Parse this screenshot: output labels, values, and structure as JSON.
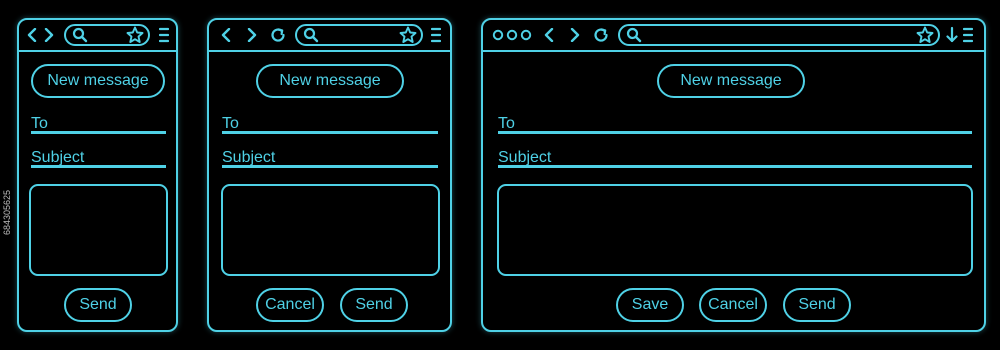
{
  "windows": [
    {
      "compose": {
        "new_message_label": "New message",
        "to_label": "To",
        "subject_label": "Subject",
        "send_label": "Send"
      },
      "toolbar_icons": [
        "back-icon",
        "forward-icon",
        "search-icon",
        "star-icon",
        "menu-icon"
      ]
    },
    {
      "compose": {
        "new_message_label": "New message",
        "to_label": "To",
        "subject_label": "Subject",
        "cancel_label": "Cancel",
        "send_label": "Send"
      },
      "toolbar_icons": [
        "back-icon",
        "forward-icon",
        "reload-icon",
        "search-icon",
        "star-icon",
        "menu-icon"
      ]
    },
    {
      "compose": {
        "new_message_label": "New message",
        "to_label": "To",
        "subject_label": "Subject",
        "save_label": "Save",
        "cancel_label": "Cancel",
        "send_label": "Send"
      },
      "toolbar_icons": [
        "window-dots-icon",
        "back-icon",
        "forward-icon",
        "reload-icon",
        "search-icon",
        "star-icon",
        "download-icon",
        "menu-icon"
      ]
    }
  ],
  "colors": {
    "accent": "#4fd1e6",
    "background": "#000000"
  },
  "stock_id": "684305625"
}
